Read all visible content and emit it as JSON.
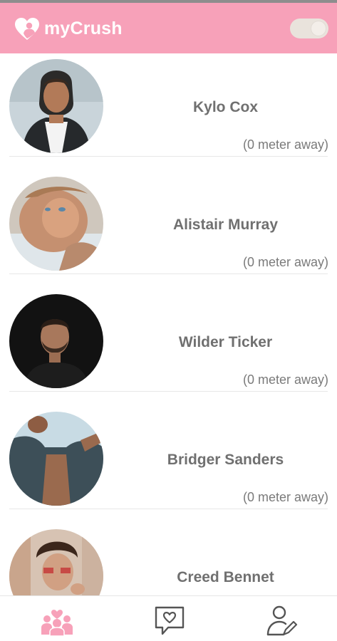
{
  "header": {
    "title": "myCrush",
    "logo_icon": "heart-person-icon",
    "toggle_state": "on",
    "colors": {
      "brand_pink": "#f7a1b9",
      "title_text": "#ffffff",
      "toggle_track": "#e9e3dc"
    }
  },
  "users": [
    {
      "name": "Kylo Cox",
      "distance": "(0 meter away)"
    },
    {
      "name": "Alistair Murray",
      "distance": "(0 meter away)"
    },
    {
      "name": "Wilder Ticker",
      "distance": "(0 meter away)"
    },
    {
      "name": "Bridger Sanders",
      "distance": "(0 meter away)"
    },
    {
      "name": "Creed Bennet",
      "distance": ""
    }
  ],
  "bottom_nav": {
    "items": [
      {
        "icon": "people-group-icon",
        "active": true,
        "color": "#f7a1b9"
      },
      {
        "icon": "chat-heart-icon",
        "active": false,
        "color": "#6f6f6f"
      },
      {
        "icon": "profile-edit-icon",
        "active": false,
        "color": "#6f6f6f"
      }
    ]
  }
}
